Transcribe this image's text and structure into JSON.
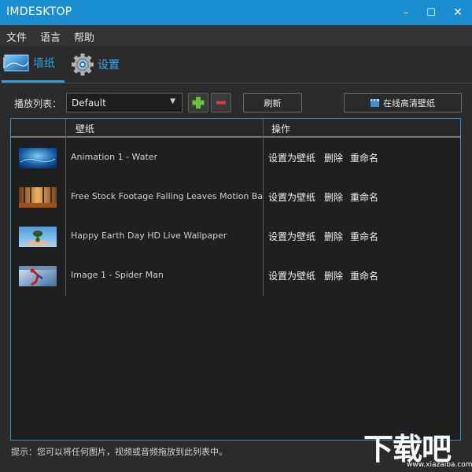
{
  "window": {
    "title": "IMDESKTOP",
    "min": "–",
    "max": "☐",
    "close": "✕"
  },
  "menu": [
    "文件",
    "语言",
    "帮助"
  ],
  "tabs": [
    {
      "label": "墙纸",
      "icon": "wallpaper-icon"
    },
    {
      "label": "设置",
      "icon": "gear-icon"
    }
  ],
  "toolbar": {
    "playlist_label": "播放列表：",
    "playlist_value": "Default",
    "refresh_label": "刷新",
    "online_label": "在线高清壁纸"
  },
  "table": {
    "columns": [
      "壁纸",
      "操作"
    ],
    "actions": [
      "设置为壁纸",
      "删除",
      "重命名"
    ],
    "rows": [
      {
        "name": "Animation 1 - Water",
        "thumb": "water"
      },
      {
        "name": "Free Stock Footage Falling Leaves Motion Backgr",
        "thumb": "leaves"
      },
      {
        "name": "Happy Earth Day HD Live Wallpaper",
        "thumb": "earth"
      },
      {
        "name": "Image 1 - Spider Man",
        "thumb": "spiderman"
      }
    ]
  },
  "hint": "提示：您可以将任何图片，视频或音频拖放到此列表中。",
  "watermark": {
    "text": "下载吧",
    "sub": "www.xiazaiba.com"
  },
  "colors": {
    "titlebar": "#1a8ed0",
    "accent": "#2d9ee0",
    "add": "#6cc23a",
    "remove": "#e03a3a"
  }
}
